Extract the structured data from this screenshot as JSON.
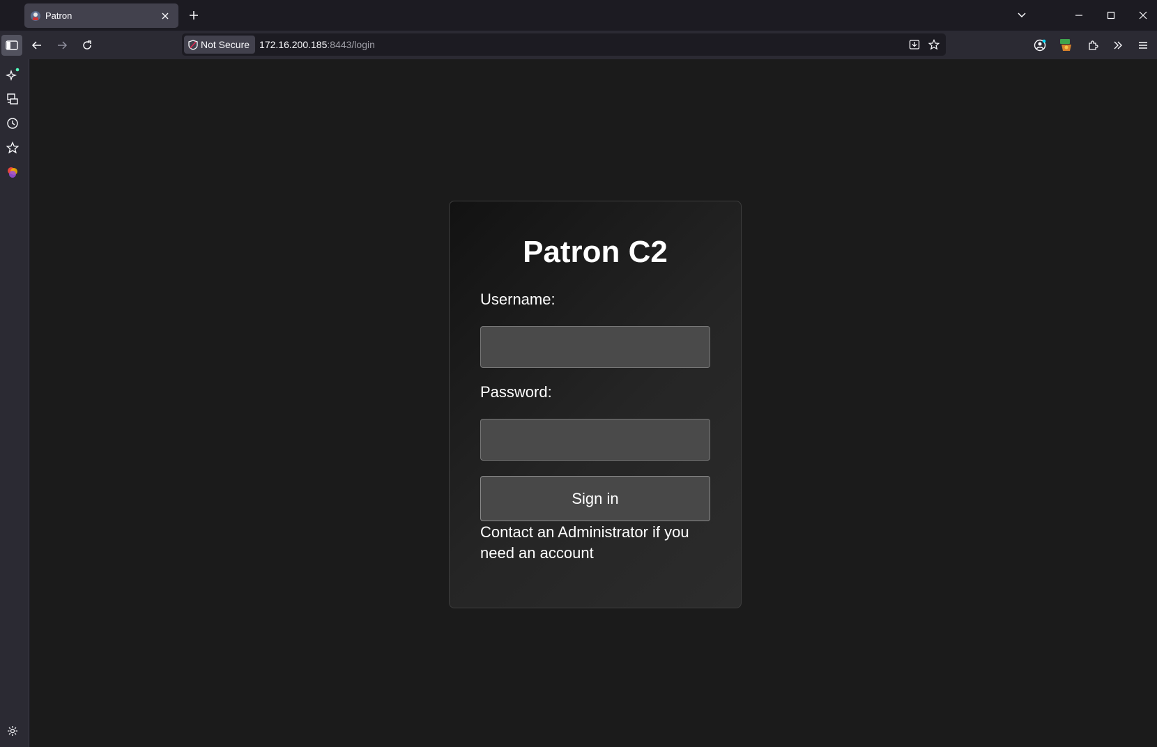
{
  "browser": {
    "tab": {
      "title": "Patron"
    },
    "url": {
      "security_label": "Not Secure",
      "host": "172.16.200.185",
      "rest": ":8443/login"
    }
  },
  "login": {
    "title": "Patron C2",
    "username_label": "Username:",
    "username_value": "",
    "password_label": "Password:",
    "password_value": "",
    "submit_label": "Sign in",
    "note": "Contact an Administrator if you need an account"
  },
  "colors": {
    "page_bg": "#1b1b1b",
    "card_bg": "#252525",
    "field_bg": "#4a4a4a",
    "text": "#ffffff"
  }
}
